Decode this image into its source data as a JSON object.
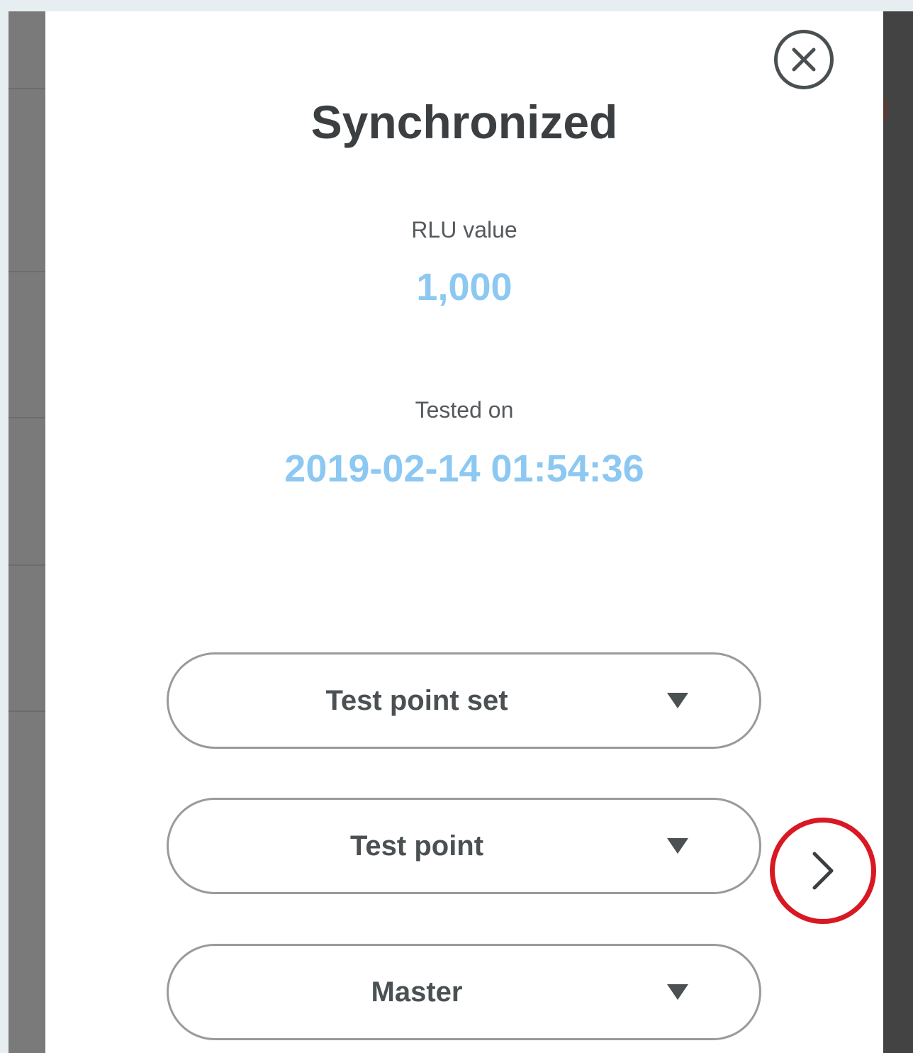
{
  "modal": {
    "title": "Synchronized",
    "rlu": {
      "label": "RLU value",
      "value": "1,000"
    },
    "tested": {
      "label": "Tested on",
      "value": "2019-02-14 01:54:36"
    },
    "selects": [
      {
        "label": "Test point set"
      },
      {
        "label": "Test point"
      },
      {
        "label": "Master"
      }
    ]
  },
  "icons": {
    "close": "close-icon",
    "next": "chevron-right-icon",
    "dropdown": "triangle-down-icon"
  },
  "colors": {
    "value_accent": "#8cc8f1",
    "highlight_ring": "#d81822",
    "title_text": "#3b3f41"
  }
}
